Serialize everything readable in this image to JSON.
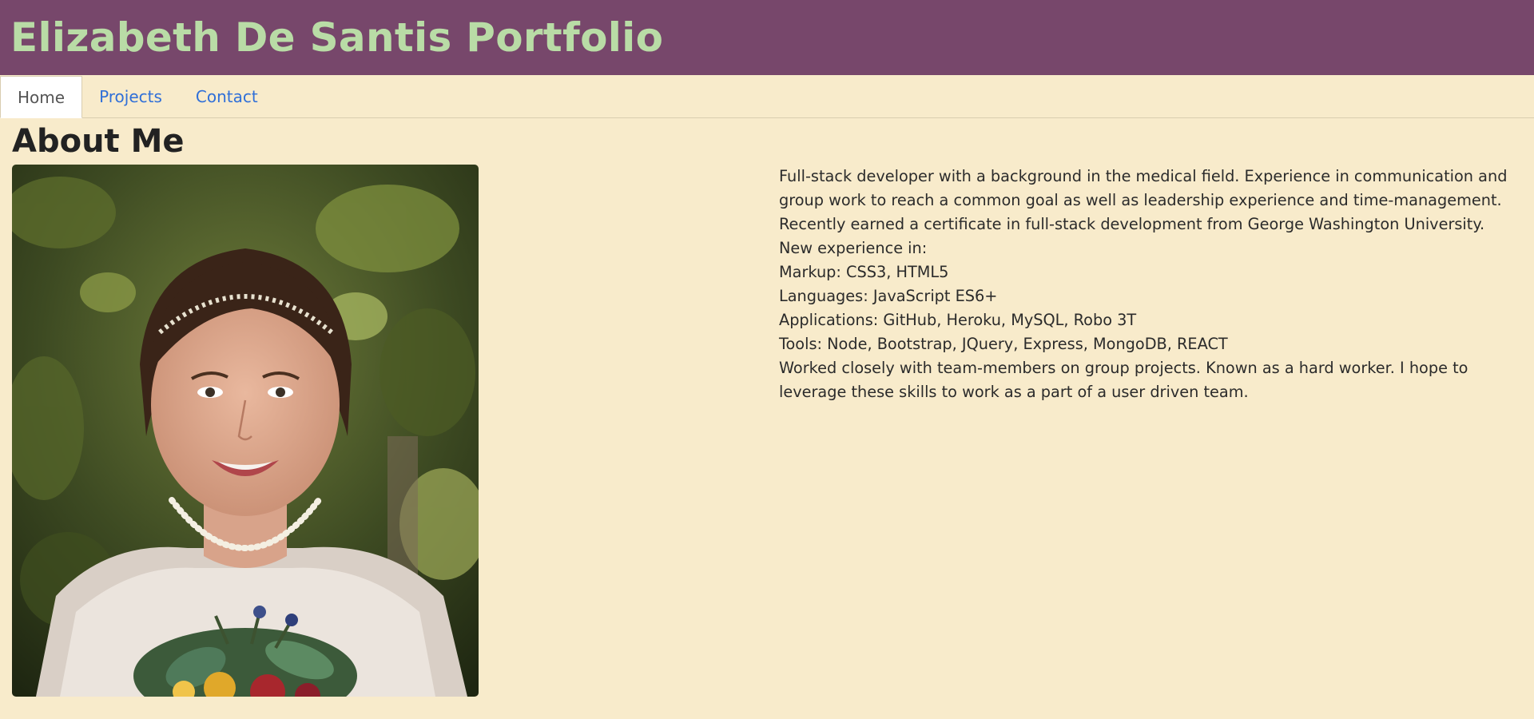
{
  "header": {
    "title": "Elizabeth De Santis Portfolio"
  },
  "nav": {
    "tabs": [
      {
        "label": "Home",
        "active": true
      },
      {
        "label": "Projects",
        "active": false
      },
      {
        "label": "Contact",
        "active": false
      }
    ]
  },
  "about": {
    "heading": "About Me",
    "paragraphs": [
      "Full-stack developer with a background in the medical field. Experience in communication and group work to reach a common goal as well as leadership experience and time-management. Recently earned a certificate in full-stack development from George Washington University. New experience in:",
      "Markup: CSS3, HTML5",
      "Languages: JavaScript ES6+",
      "Applications: GitHub, Heroku, MySQL, Robo 3T",
      "Tools: Node, Bootstrap, JQuery, Express, MongoDB, REACT",
      "Worked closely with team-members on group projects. Known as a hard worker. I hope to leverage these skills to work as a part of a user driven team."
    ]
  },
  "colors": {
    "header_bg": "#77476b",
    "title": "#b9dca6",
    "page_bg": "#f8ebcb",
    "link": "#2f6fd8"
  }
}
